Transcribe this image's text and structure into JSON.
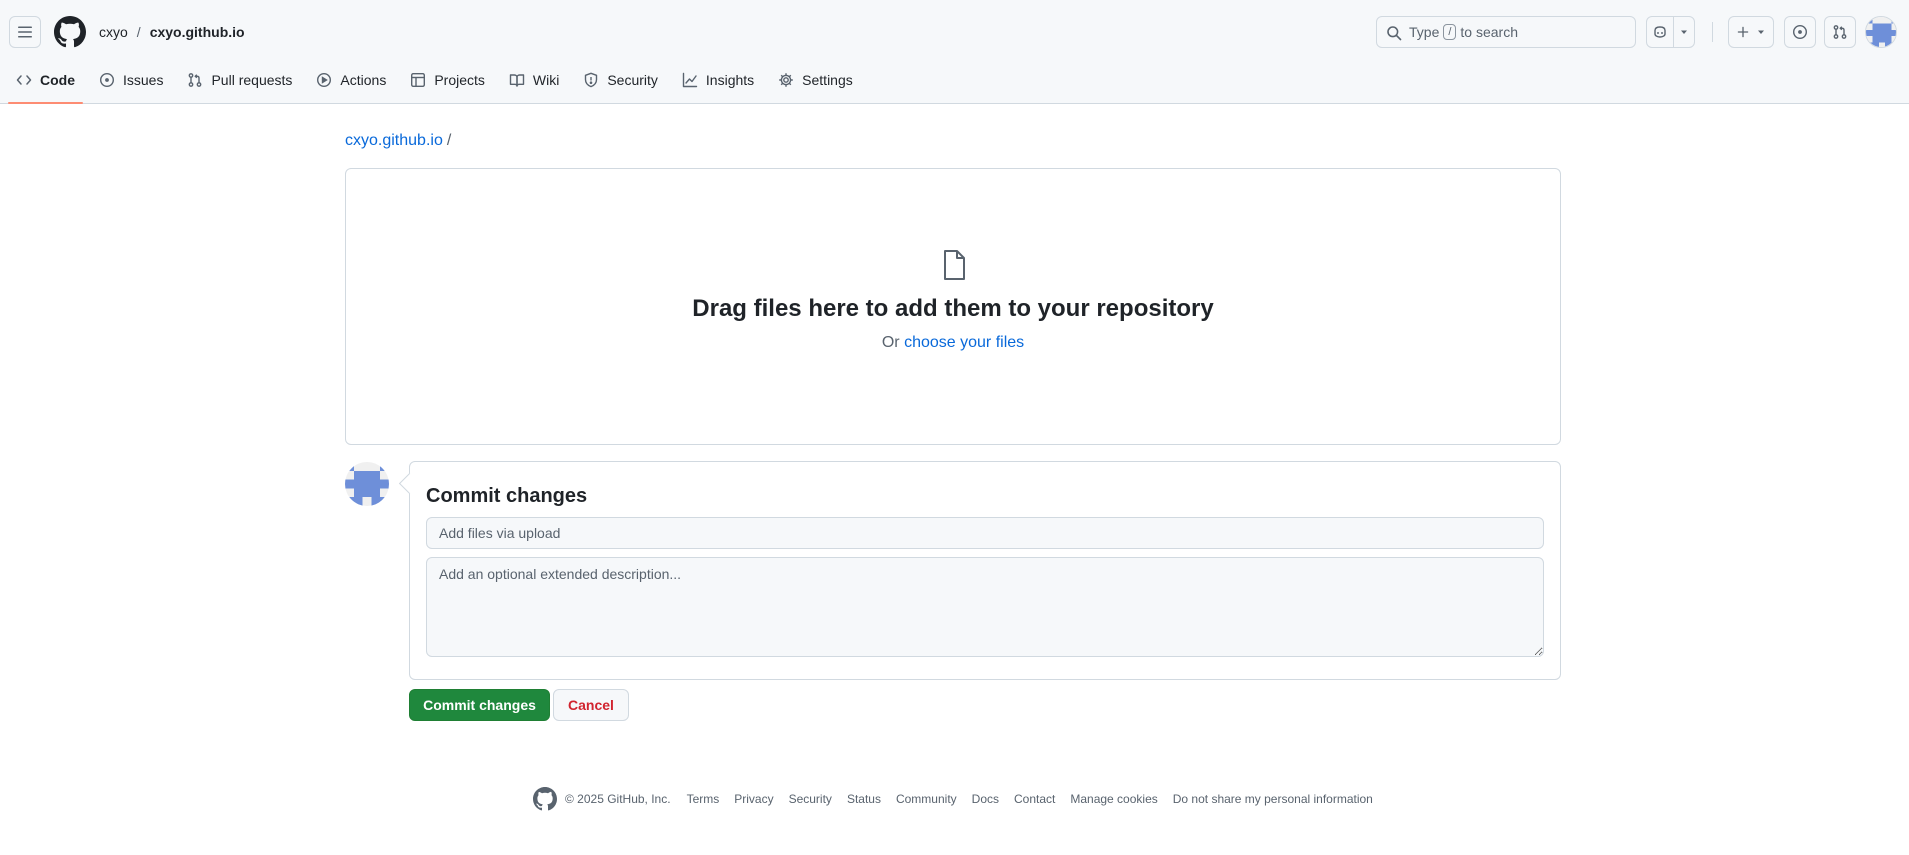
{
  "header": {
    "owner": "cxyo",
    "separator": "/",
    "repo": "cxyo.github.io",
    "search": {
      "prefix": "Type",
      "key": "/",
      "suffix": "to search"
    }
  },
  "nav": {
    "tabs": [
      {
        "label": "Code",
        "icon": "code-icon",
        "selected": true
      },
      {
        "label": "Issues",
        "icon": "issue-opened-icon"
      },
      {
        "label": "Pull requests",
        "icon": "git-pull-request-icon"
      },
      {
        "label": "Actions",
        "icon": "play-icon"
      },
      {
        "label": "Projects",
        "icon": "table-icon"
      },
      {
        "label": "Wiki",
        "icon": "book-icon"
      },
      {
        "label": "Security",
        "icon": "shield-icon"
      },
      {
        "label": "Insights",
        "icon": "graph-icon"
      },
      {
        "label": "Settings",
        "icon": "gear-icon"
      }
    ]
  },
  "breadcrumb": {
    "repo_link": "cxyo.github.io",
    "separator": "/"
  },
  "dropzone": {
    "title": "Drag files here to add them to your repository",
    "prefix": "Or",
    "link": "choose your files"
  },
  "commit": {
    "title": "Commit changes",
    "summary_placeholder": "Add files via upload",
    "description_placeholder": "Add an optional extended description...",
    "commit_button": "Commit changes",
    "cancel_button": "Cancel"
  },
  "footer": {
    "copyright": "© 2025 GitHub, Inc.",
    "links": [
      "Terms",
      "Privacy",
      "Security",
      "Status",
      "Community",
      "Docs",
      "Contact",
      "Manage cookies",
      "Do not share my personal information"
    ]
  },
  "colors": {
    "accent": "#0969da",
    "primary_button": "#1f883d",
    "danger": "#d1242f",
    "tab_underline": "#fd8c73",
    "avatar": "#6e8fd9"
  }
}
